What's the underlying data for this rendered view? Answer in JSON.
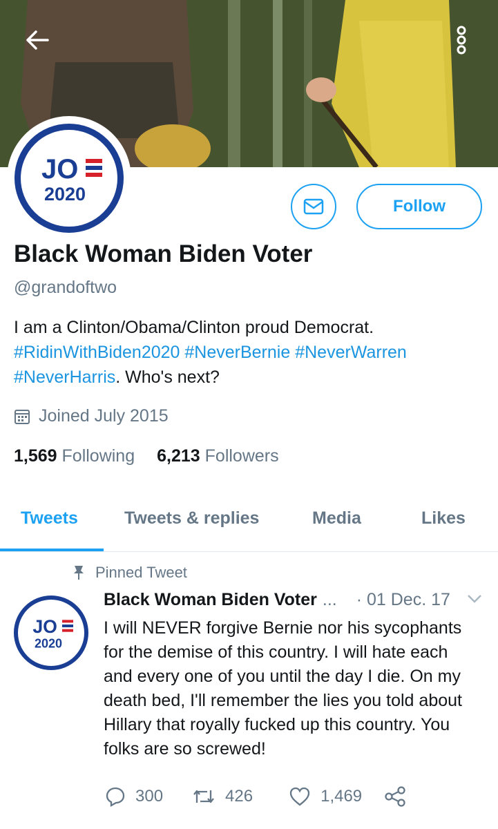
{
  "banner": {
    "back_icon": "arrow-left-icon",
    "more_icon": "more-vertical-icon"
  },
  "profile": {
    "avatar_text_top": "JO",
    "avatar_text_bottom": "2020",
    "message_icon": "envelope-icon",
    "follow_label": "Follow",
    "name": "Black Woman Biden Voter",
    "handle": "@grandoftwo",
    "bio_line1": "I am a Clinton/Obama/Clinton proud Democrat.",
    "bio_tags": [
      "#RidinWithBiden2020",
      "#NeverBernie",
      "#NeverWarren",
      "#NeverHarris"
    ],
    "bio_tail": ". Who's next?",
    "joined": "Joined July 2015",
    "following_count": "1,569",
    "following_label": "Following",
    "followers_count": "6,213",
    "followers_label": "Followers"
  },
  "tabs": [
    {
      "label": "Tweets",
      "active": true
    },
    {
      "label": "Tweets & replies",
      "active": false
    },
    {
      "label": "Media",
      "active": false
    },
    {
      "label": "Likes",
      "active": false
    }
  ],
  "tweet": {
    "pinned_label": "Pinned Tweet",
    "author": "Black Woman Biden Voter",
    "ellipsis": "...",
    "date": "· 01 Dec. 17",
    "text": "I will NEVER forgive Bernie nor his sycophants for the demise of this country. I will hate each and every one of you until the day I die. On my death bed, I'll remember the lies you told about Hillary that royally fucked up this country. You folks are so screwed!",
    "replies": "300",
    "retweets": "426",
    "likes": "1,469"
  },
  "colors": {
    "accent": "#1da1f2",
    "link": "#1b95e0",
    "muted": "#657786",
    "logo_blue": "#1a3e94",
    "logo_red": "#d6212b"
  }
}
